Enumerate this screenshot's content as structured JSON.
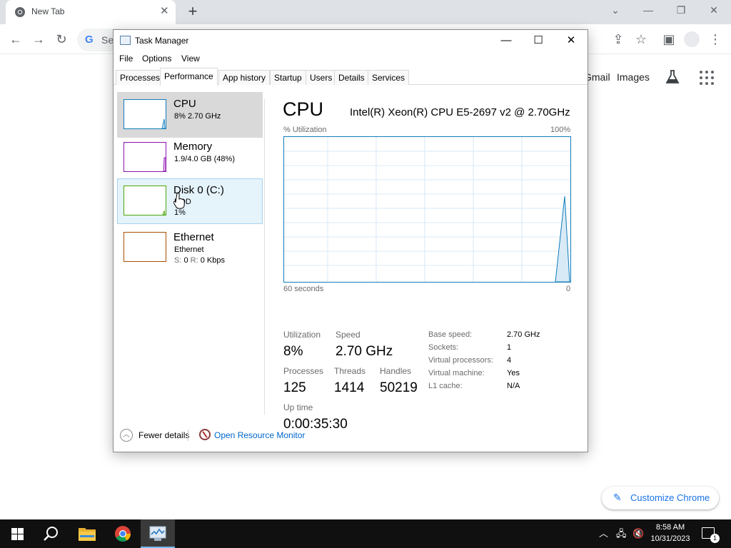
{
  "browser": {
    "tab_title": "New Tab",
    "omnibox_text": "Se",
    "links": {
      "gmail": "Gmail",
      "images": "Images"
    },
    "customize_label": "Customize Chrome"
  },
  "task_manager": {
    "window_title": "Task Manager",
    "menu": [
      "File",
      "Options",
      "View"
    ],
    "tabs": [
      "Processes",
      "Performance",
      "App history",
      "Startup",
      "Users",
      "Details",
      "Services"
    ],
    "active_tab": "Performance",
    "resources": [
      {
        "name": "CPU",
        "detail": "8%  2.70 GHz",
        "graph_color": "#117dbb"
      },
      {
        "name": "Memory",
        "detail": "1.9/4.0 GB (48%)",
        "graph_color": "#8b12ae"
      },
      {
        "name": "Disk 0 (C:)",
        "detail": "HDD",
        "detail2": "1%",
        "graph_color": "#4da60c"
      },
      {
        "name": "Ethernet",
        "detail": "Ethernet",
        "send_label": "S:",
        "send_value": "0",
        "recv_label": "R:",
        "recv_value": "0 Kbps",
        "graph_color": "#a74f01"
      }
    ],
    "cpu": {
      "title": "CPU",
      "model": "Intel(R) Xeon(R) CPU E5-2697 v2 @ 2.70GHz",
      "graph_label": "% Utilization",
      "graph_max": "100%",
      "graph_time": "60 seconds",
      "graph_min": "0",
      "utilization_label": "Utilization",
      "utilization": "8%",
      "speed_label": "Speed",
      "speed": "2.70 GHz",
      "processes_label": "Processes",
      "processes": "125",
      "threads_label": "Threads",
      "threads": "1414",
      "handles_label": "Handles",
      "handles": "50219",
      "uptime_label": "Up time",
      "uptime": "0:00:35:30",
      "specs": [
        {
          "label": "Base speed:",
          "value": "2.70 GHz"
        },
        {
          "label": "Sockets:",
          "value": "1"
        },
        {
          "label": "Virtual processors:",
          "value": "4"
        },
        {
          "label": "Virtual machine:",
          "value": "Yes"
        },
        {
          "label": "L1 cache:",
          "value": "N/A"
        }
      ]
    },
    "footer": {
      "fewer_details": "Fewer details",
      "resource_monitor": "Open Resource Monitor"
    }
  },
  "taskbar": {
    "time": "8:58 AM",
    "date": "10/31/2023",
    "notification_count": "1"
  }
}
